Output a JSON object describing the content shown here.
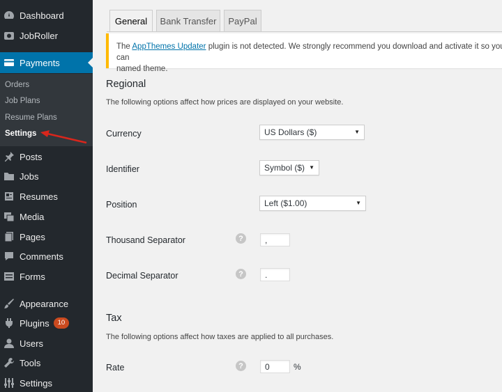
{
  "sidebar": {
    "items": [
      {
        "label": "Dashboard",
        "icon": "dashboard-icon"
      },
      {
        "label": "JobRoller",
        "icon": "jobroller-icon"
      },
      {
        "label": "Payments",
        "icon": "payments-icon",
        "active": true
      },
      {
        "label": "Posts",
        "icon": "pin-icon"
      },
      {
        "label": "Jobs",
        "icon": "folder-icon"
      },
      {
        "label": "Resumes",
        "icon": "resume-icon"
      },
      {
        "label": "Media",
        "icon": "media-icon"
      },
      {
        "label": "Pages",
        "icon": "pages-icon"
      },
      {
        "label": "Comments",
        "icon": "comment-icon"
      },
      {
        "label": "Forms",
        "icon": "forms-icon"
      },
      {
        "label": "Appearance",
        "icon": "brush-icon"
      },
      {
        "label": "Plugins",
        "icon": "plugin-icon",
        "badge": "10"
      },
      {
        "label": "Users",
        "icon": "user-icon"
      },
      {
        "label": "Tools",
        "icon": "wrench-icon"
      },
      {
        "label": "Settings",
        "icon": "settings-icon"
      }
    ],
    "submenu": [
      {
        "label": "Orders"
      },
      {
        "label": "Job Plans"
      },
      {
        "label": "Resume Plans"
      },
      {
        "label": "Settings",
        "current": true
      }
    ]
  },
  "tabs": [
    "General",
    "Bank Transfer",
    "PayPal"
  ],
  "notice": {
    "prefix": "The ",
    "link": "AppThemes Updater",
    "rest": " plugin is not detected. We strongly recommend you download and activate it so you can",
    "line2": "named theme."
  },
  "regional": {
    "title": "Regional",
    "description": "The following options affect how prices are displayed on your website.",
    "currency_label": "Currency",
    "currency_value": "US Dollars ($)",
    "identifier_label": "Identifier",
    "identifier_value": "Symbol ($)",
    "position_label": "Position",
    "position_value": "Left ($1.00)",
    "thousand_label": "Thousand Separator",
    "thousand_value": ",",
    "decimal_label": "Decimal Separator",
    "decimal_value": "."
  },
  "tax": {
    "title": "Tax",
    "description": "The following options affect how taxes are applied to all purchases.",
    "rate_label": "Rate",
    "rate_value": "0",
    "rate_suffix": "%"
  },
  "help_glyph": "?",
  "caret_glyph": "▼",
  "colors": {
    "sidebar_bg": "#23282d",
    "active_bg": "#0073aa",
    "notice_accent": "#ffb900",
    "badge_bg": "#ca4a1f",
    "arrow": "#d9261c"
  }
}
